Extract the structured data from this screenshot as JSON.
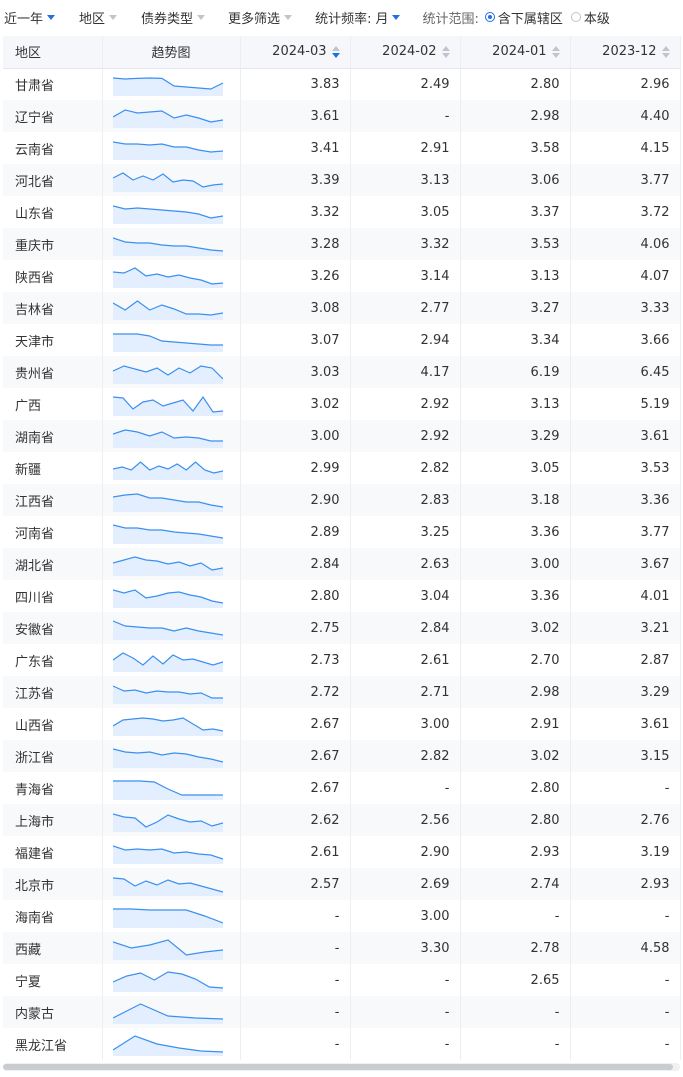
{
  "filters": {
    "period": "近一年",
    "region": "地区",
    "bond_type": "债券类型",
    "more": "更多筛选",
    "freq_label": "统计频率:",
    "freq_value": "月",
    "scope_label": "统计范围:",
    "scope_opt1": "含下属辖区",
    "scope_opt2": "本级",
    "scope_selected": "含下属辖区"
  },
  "table": {
    "columns": [
      "地区",
      "趋势图",
      "2024-03",
      "2024-02",
      "2024-01",
      "2023-12"
    ],
    "sorted_column": "2024-03",
    "sort_direction": "desc",
    "rows": [
      {
        "region": "甘肃省",
        "v": [
          "3.83",
          "2.49",
          "2.80",
          "2.96"
        ],
        "trend": [
          0.2,
          0.25,
          0.22,
          0.2,
          0.22,
          0.6,
          0.65,
          0.7,
          0.75,
          0.45
        ]
      },
      {
        "region": "辽宁省",
        "v": [
          "3.61",
          "-",
          "2.98",
          "4.40"
        ],
        "trend": [
          0.55,
          0.2,
          0.35,
          0.3,
          0.25,
          0.6,
          0.45,
          0.6,
          0.8,
          0.7
        ]
      },
      {
        "region": "云南省",
        "v": [
          "3.41",
          "2.91",
          "3.58",
          "4.15"
        ],
        "trend": [
          0.2,
          0.3,
          0.3,
          0.35,
          0.3,
          0.45,
          0.45,
          0.6,
          0.7,
          0.65
        ]
      },
      {
        "region": "河北省",
        "v": [
          "3.39",
          "3.13",
          "3.06",
          "3.77"
        ],
        "trend": [
          0.4,
          0.15,
          0.5,
          0.3,
          0.5,
          0.2,
          0.6,
          0.5,
          0.55,
          0.85,
          0.75,
          0.7
        ]
      },
      {
        "region": "山东省",
        "v": [
          "3.32",
          "3.05",
          "3.37",
          "3.72"
        ],
        "trend": [
          0.2,
          0.35,
          0.3,
          0.35,
          0.4,
          0.45,
          0.5,
          0.6,
          0.8,
          0.7
        ]
      },
      {
        "region": "重庆市",
        "v": [
          "3.28",
          "3.32",
          "3.53",
          "4.06"
        ],
        "trend": [
          0.2,
          0.4,
          0.45,
          0.45,
          0.55,
          0.6,
          0.6,
          0.7,
          0.8,
          0.85
        ]
      },
      {
        "region": "陕西省",
        "v": [
          "3.26",
          "3.14",
          "3.13",
          "4.07"
        ],
        "trend": [
          0.3,
          0.35,
          0.1,
          0.5,
          0.4,
          0.55,
          0.45,
          0.6,
          0.7,
          0.9,
          0.85
        ]
      },
      {
        "region": "吉林省",
        "v": [
          "3.08",
          "2.77",
          "3.27",
          "3.33"
        ],
        "trend": [
          0.25,
          0.6,
          0.15,
          0.6,
          0.35,
          0.55,
          0.8,
          0.8,
          0.85,
          0.75
        ]
      },
      {
        "region": "天津市",
        "v": [
          "3.07",
          "2.94",
          "3.34",
          "3.66"
        ],
        "trend": [
          0.2,
          0.2,
          0.2,
          0.3,
          0.55,
          0.6,
          0.65,
          0.7,
          0.75,
          0.75
        ]
      },
      {
        "region": "贵州省",
        "v": [
          "3.03",
          "4.17",
          "6.19",
          "6.45"
        ],
        "trend": [
          0.45,
          0.2,
          0.35,
          0.5,
          0.3,
          0.65,
          0.3,
          0.55,
          0.2,
          0.3,
          0.85
        ]
      },
      {
        "region": "广西",
        "v": [
          "3.02",
          "2.92",
          "3.13",
          "5.19"
        ],
        "trend": [
          0.15,
          0.2,
          0.75,
          0.4,
          0.3,
          0.6,
          0.45,
          0.3,
          0.85,
          0.15,
          0.9,
          0.85
        ]
      },
      {
        "region": "湖南省",
        "v": [
          "3.00",
          "2.92",
          "3.29",
          "3.61"
        ],
        "trend": [
          0.4,
          0.2,
          0.3,
          0.5,
          0.3,
          0.6,
          0.55,
          0.6,
          0.75,
          0.75
        ]
      },
      {
        "region": "新疆",
        "v": [
          "2.99",
          "2.82",
          "3.05",
          "3.53"
        ],
        "trend": [
          0.55,
          0.45,
          0.6,
          0.2,
          0.6,
          0.4,
          0.55,
          0.3,
          0.6,
          0.2,
          0.6,
          0.75,
          0.65
        ]
      },
      {
        "region": "江西省",
        "v": [
          "2.90",
          "2.83",
          "3.18",
          "3.36"
        ],
        "trend": [
          0.35,
          0.25,
          0.2,
          0.4,
          0.4,
          0.5,
          0.6,
          0.6,
          0.75,
          0.85
        ]
      },
      {
        "region": "河南省",
        "v": [
          "2.89",
          "3.25",
          "3.36",
          "3.77"
        ],
        "trend": [
          0.15,
          0.3,
          0.3,
          0.4,
          0.4,
          0.5,
          0.55,
          0.6,
          0.7,
          0.8
        ]
      },
      {
        "region": "湖北省",
        "v": [
          "2.84",
          "2.63",
          "3.00",
          "3.67"
        ],
        "trend": [
          0.45,
          0.3,
          0.15,
          0.3,
          0.35,
          0.5,
          0.4,
          0.6,
          0.45,
          0.8,
          0.7
        ]
      },
      {
        "region": "四川省",
        "v": [
          "2.80",
          "3.04",
          "3.36",
          "4.01"
        ],
        "trend": [
          0.2,
          0.35,
          0.2,
          0.6,
          0.5,
          0.35,
          0.3,
          0.45,
          0.55,
          0.75,
          0.85
        ]
      },
      {
        "region": "安徽省",
        "v": [
          "2.75",
          "2.84",
          "3.02",
          "3.21"
        ],
        "trend": [
          0.15,
          0.4,
          0.45,
          0.5,
          0.5,
          0.65,
          0.5,
          0.65,
          0.75,
          0.85
        ]
      },
      {
        "region": "广东省",
        "v": [
          "2.73",
          "2.61",
          "2.70",
          "2.87"
        ],
        "trend": [
          0.5,
          0.15,
          0.4,
          0.75,
          0.3,
          0.7,
          0.25,
          0.5,
          0.45,
          0.6,
          0.75,
          0.6
        ]
      },
      {
        "region": "江苏省",
        "v": [
          "2.72",
          "2.71",
          "2.98",
          "3.29"
        ],
        "trend": [
          0.2,
          0.45,
          0.4,
          0.55,
          0.45,
          0.5,
          0.5,
          0.6,
          0.55,
          0.8,
          0.8
        ]
      },
      {
        "region": "山西省",
        "v": [
          "2.67",
          "3.00",
          "2.91",
          "3.61"
        ],
        "trend": [
          0.6,
          0.3,
          0.25,
          0.2,
          0.25,
          0.35,
          0.3,
          0.2,
          0.5,
          0.8,
          0.75,
          0.85
        ]
      },
      {
        "region": "浙江省",
        "v": [
          "2.67",
          "2.82",
          "3.02",
          "3.15"
        ],
        "trend": [
          0.15,
          0.3,
          0.35,
          0.3,
          0.45,
          0.35,
          0.4,
          0.55,
          0.65,
          0.8
        ]
      },
      {
        "region": "青海省",
        "v": [
          "2.67",
          "-",
          "2.80",
          "-"
        ],
        "trend": [
          0.15,
          0.15,
          0.15,
          0.2,
          0.55,
          0.85,
          0.85,
          0.85,
          0.85
        ]
      },
      {
        "region": "上海市",
        "v": [
          "2.62",
          "2.56",
          "2.80",
          "2.76"
        ],
        "trend": [
          0.2,
          0.35,
          0.4,
          0.85,
          0.6,
          0.25,
          0.45,
          0.6,
          0.55,
          0.8,
          0.65
        ]
      },
      {
        "region": "福建省",
        "v": [
          "2.61",
          "2.90",
          "2.93",
          "3.19"
        ],
        "trend": [
          0.2,
          0.4,
          0.35,
          0.4,
          0.35,
          0.55,
          0.5,
          0.6,
          0.65,
          0.85
        ]
      },
      {
        "region": "北京市",
        "v": [
          "2.57",
          "2.69",
          "2.74",
          "2.93"
        ],
        "trend": [
          0.2,
          0.25,
          0.6,
          0.35,
          0.55,
          0.3,
          0.5,
          0.45,
          0.6,
          0.75,
          0.9
        ]
      },
      {
        "region": "海南省",
        "v": [
          "-",
          "3.00",
          "-",
          "-"
        ],
        "trend": [
          0.15,
          0.15,
          0.2,
          0.2,
          0.2,
          0.5,
          0.85
        ]
      },
      {
        "region": "西藏",
        "v": [
          "-",
          "3.30",
          "2.78",
          "4.58"
        ],
        "trend": [
          0.2,
          0.5,
          0.35,
          0.1,
          0.85,
          0.7,
          0.6
        ]
      },
      {
        "region": "宁夏",
        "v": [
          "-",
          "-",
          "2.65",
          "-"
        ],
        "trend": [
          0.6,
          0.3,
          0.15,
          0.5,
          0.1,
          0.2,
          0.45,
          0.85,
          0.9
        ]
      },
      {
        "region": "内蒙古",
        "v": [
          "-",
          "-",
          "-",
          "-"
        ],
        "trend": [
          0.8,
          0.1,
          0.7,
          0.8,
          0.85
        ]
      },
      {
        "region": "黑龙江省",
        "v": [
          "-",
          "-",
          "-",
          "-"
        ],
        "trend": [
          0.8,
          0.1,
          0.5,
          0.7,
          0.85,
          0.9
        ]
      }
    ]
  },
  "colors": {
    "accent": "#1f6fe5",
    "spark_line": "#3b8ff0",
    "spark_fill": "#e3efff"
  }
}
